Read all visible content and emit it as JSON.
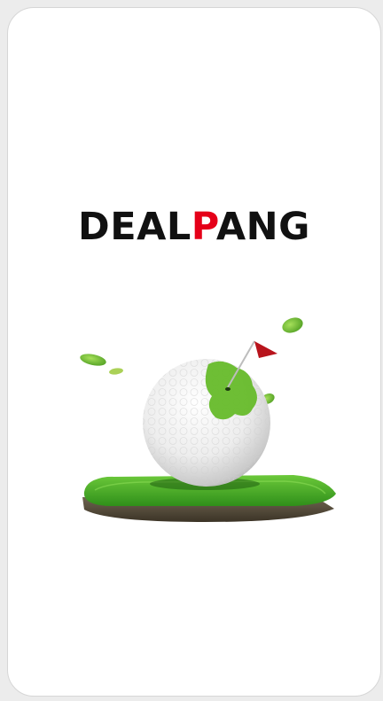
{
  "splash": {
    "logo": {
      "part1": "DEAL",
      "accent": "P",
      "part2": "ANG"
    },
    "colors": {
      "background": "#ffffff",
      "logo_text": "#111111",
      "logo_accent": "#e50019",
      "grass": "#4caf2a",
      "flag": "#b8141c"
    },
    "illustration": {
      "subject": "golf-ball-on-grass-turf-with-flag",
      "icon": "golf-ball-icon"
    }
  }
}
